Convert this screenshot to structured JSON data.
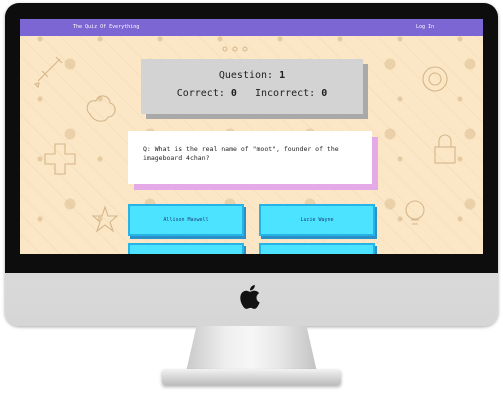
{
  "nav": {
    "title": "The Quiz Of Everything",
    "login": "Log In"
  },
  "score": {
    "question_label": "Question:",
    "question_number": "1",
    "correct_label": "Correct:",
    "correct_value": "0",
    "incorrect_label": "Incorrect:",
    "incorrect_value": "0"
  },
  "question": {
    "text": "Q: What is the real name of \"moot\", founder of the imageboard 4chan?"
  },
  "answers": [
    {
      "label": "Allison Maxwell"
    },
    {
      "label": "Lucie Wayne"
    },
    {
      "label": ""
    },
    {
      "label": ""
    }
  ],
  "colors": {
    "nav": "#7b66d3",
    "background": "#fbe7c6",
    "answer_button": "#4be3ff",
    "question_shadow": "#e5a9e8"
  },
  "icons": [
    "apple-logo-icon"
  ]
}
